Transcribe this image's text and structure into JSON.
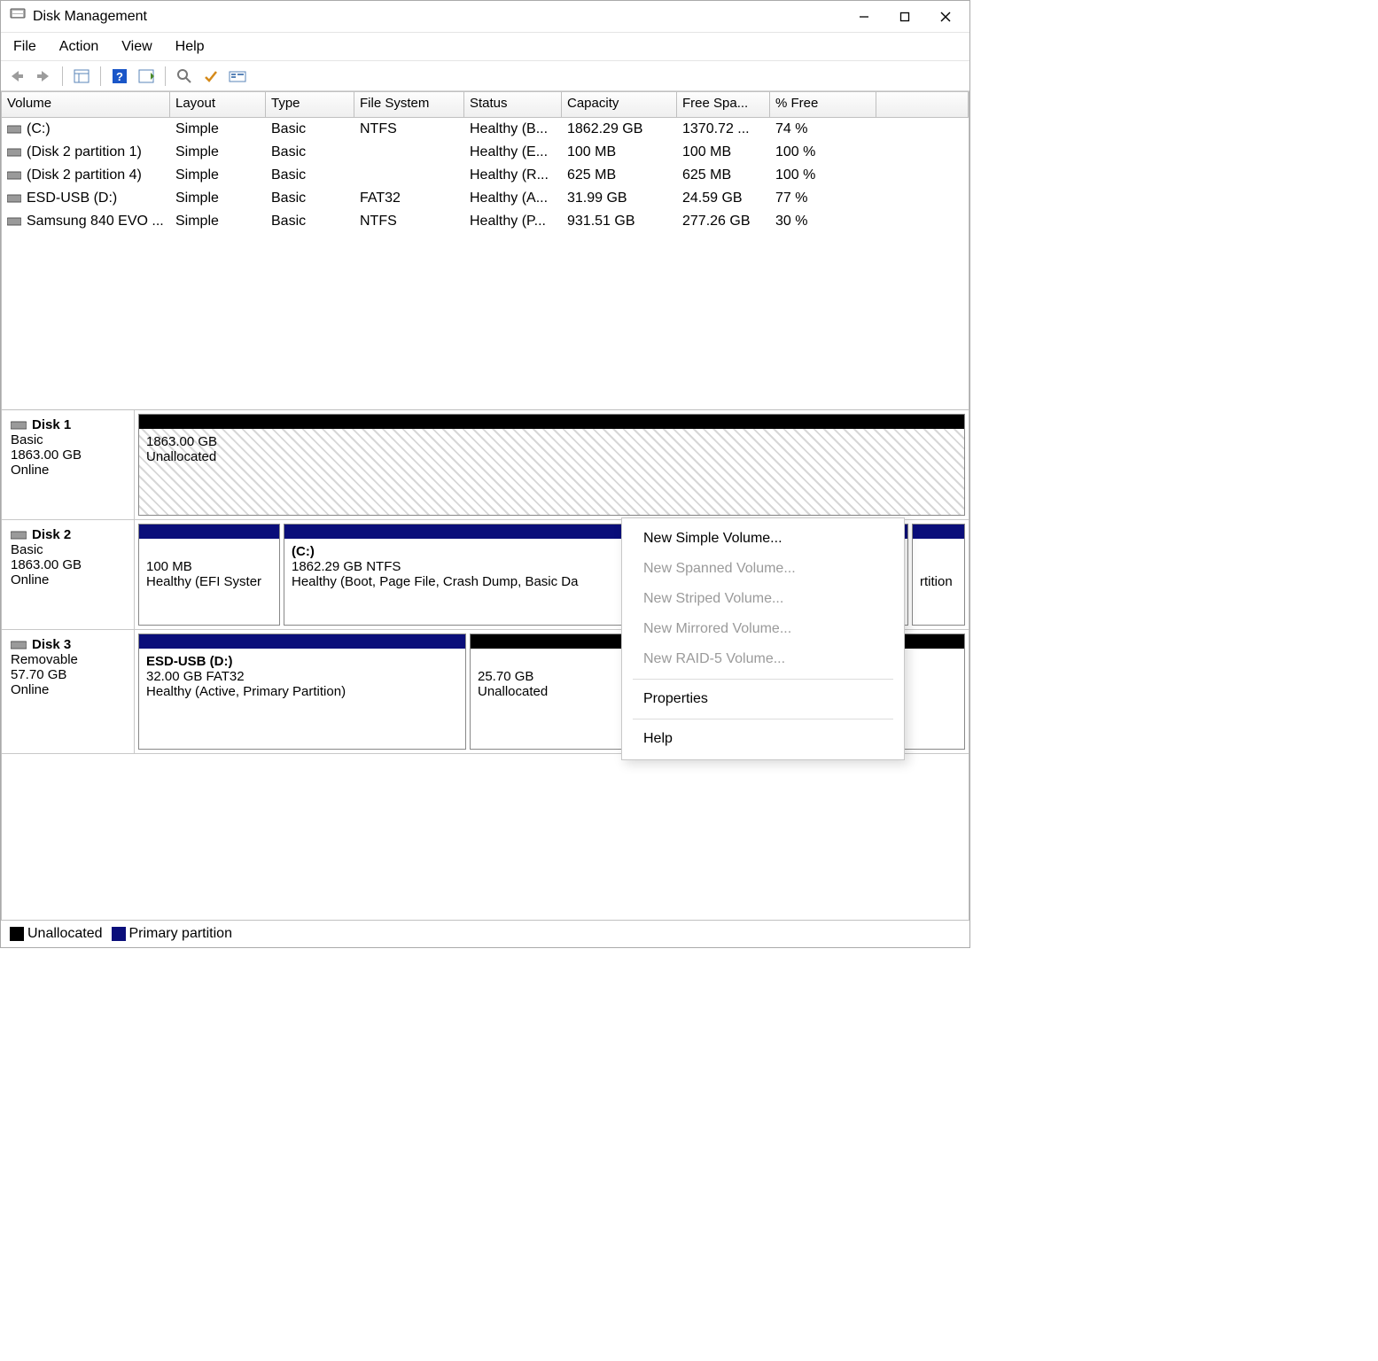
{
  "window": {
    "title": "Disk Management"
  },
  "menu": {
    "file": "File",
    "action": "Action",
    "view": "View",
    "help": "Help"
  },
  "columns": {
    "volume": "Volume",
    "layout": "Layout",
    "type": "Type",
    "fs": "File System",
    "status": "Status",
    "capacity": "Capacity",
    "free": "Free Spa...",
    "pctfree": "% Free"
  },
  "volumes": [
    {
      "name": "(C:)",
      "layout": "Simple",
      "type": "Basic",
      "fs": "NTFS",
      "status": "Healthy (B...",
      "capacity": "1862.29 GB",
      "free": "1370.72 ...",
      "pct": "74 %"
    },
    {
      "name": "(Disk 2 partition 1)",
      "layout": "Simple",
      "type": "Basic",
      "fs": "",
      "status": "Healthy (E...",
      "capacity": "100 MB",
      "free": "100 MB",
      "pct": "100 %"
    },
    {
      "name": "(Disk 2 partition 4)",
      "layout": "Simple",
      "type": "Basic",
      "fs": "",
      "status": "Healthy (R...",
      "capacity": "625 MB",
      "free": "625 MB",
      "pct": "100 %"
    },
    {
      "name": "ESD-USB (D:)",
      "layout": "Simple",
      "type": "Basic",
      "fs": "FAT32",
      "status": "Healthy (A...",
      "capacity": "31.99 GB",
      "free": "24.59 GB",
      "pct": "77 %"
    },
    {
      "name": "Samsung 840 EVO ...",
      "layout": "Simple",
      "type": "Basic",
      "fs": "NTFS",
      "status": "Healthy (P...",
      "capacity": "931.51 GB",
      "free": "277.26 GB",
      "pct": "30 %"
    }
  ],
  "disks": {
    "d1": {
      "name": "Disk 1",
      "type": "Basic",
      "size": "1863.00 GB",
      "status": "Online",
      "p0": {
        "size": "1863.00 GB",
        "state": "Unallocated"
      }
    },
    "d2": {
      "name": "Disk 2",
      "type": "Basic",
      "size": "1863.00 GB",
      "status": "Online",
      "p0": {
        "size": "100 MB",
        "state": "Healthy (EFI Syster"
      },
      "p1": {
        "title": "(C:)",
        "detail": "1862.29 GB NTFS",
        "state": "Healthy (Boot, Page File, Crash Dump, Basic Da"
      },
      "p2": {
        "state": "rtition"
      }
    },
    "d3": {
      "name": "Disk 3",
      "type": "Removable",
      "size": "57.70 GB",
      "status": "Online",
      "p0": {
        "title": "ESD-USB  (D:)",
        "detail": "32.00 GB FAT32",
        "state": "Healthy (Active, Primary Partition)"
      },
      "p1": {
        "size": "25.70 GB",
        "state": "Unallocated"
      }
    }
  },
  "legend": {
    "unallocated": "Unallocated",
    "primary": "Primary partition"
  },
  "ctx": {
    "new_simple": "New Simple Volume...",
    "new_spanned": "New Spanned Volume...",
    "new_striped": "New Striped Volume...",
    "new_mirrored": "New Mirrored Volume...",
    "new_raid5": "New RAID-5 Volume...",
    "properties": "Properties",
    "help": "Help"
  }
}
